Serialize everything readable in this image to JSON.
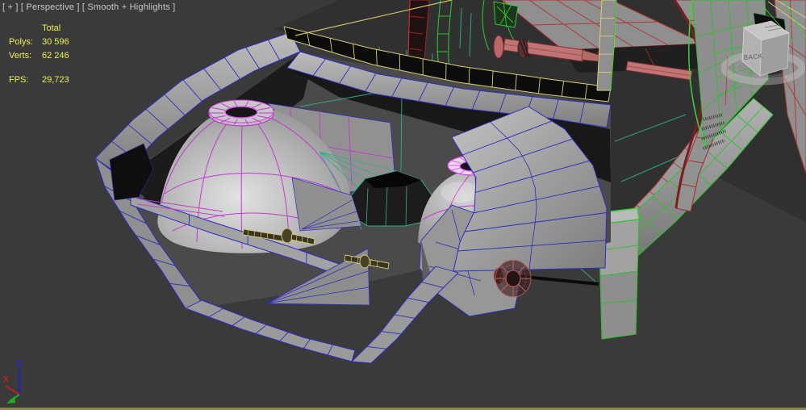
{
  "viewport": {
    "label": "[ + ] [ Perspective ] [ Smooth + Highlights ]",
    "view_mode": "Perspective",
    "shading_mode": "Smooth + Highlights"
  },
  "stats": {
    "header": "Total",
    "rows": [
      {
        "label": "Polys:",
        "value": "30 596"
      },
      {
        "label": "Verts:",
        "value": "62 246"
      }
    ],
    "fps": {
      "label": "FPS:",
      "value": "29,723"
    }
  },
  "viewcube": {
    "front_label": "BACK"
  },
  "axes": {
    "x": "X",
    "z": "Z"
  },
  "colors": {
    "background": "#3a3a3a",
    "stats_text": "#efee56",
    "label_text": "#c9c9c9",
    "viewport_border": "#8a8a52",
    "wire_blue": "#2b2bc0",
    "wire_green": "#2fbf2f",
    "wire_green_bright": "#3ad43a",
    "wire_teal": "#2fae8e",
    "wire_red": "#b43232",
    "wire_dark_red": "#8a2020",
    "wire_magenta": "#c438d4",
    "wire_magenta_bright": "#ee55ff",
    "wire_yellow": "#d9cf72",
    "axis_x": "#bb2222",
    "axis_y": "#1fae1f",
    "axis_z": "#2222cc",
    "surface_gray": "#9a9a9a"
  }
}
